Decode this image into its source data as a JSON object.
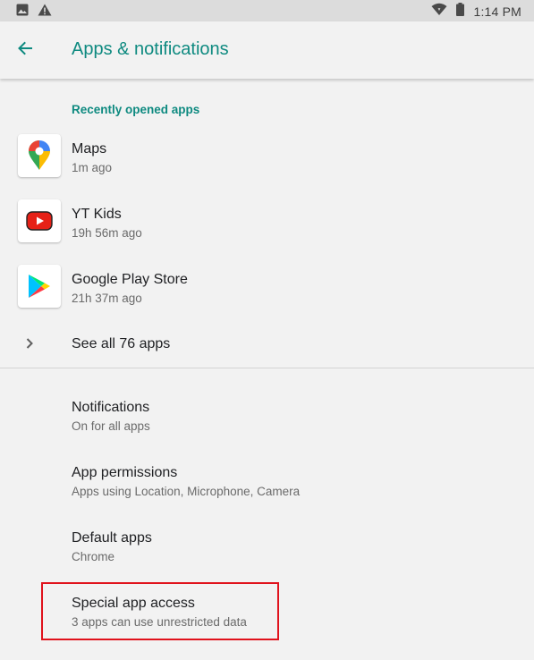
{
  "status_bar": {
    "time": "1:14 PM",
    "icons": [
      "image-icon",
      "warning-icon",
      "wifi-icon",
      "battery-icon"
    ]
  },
  "header": {
    "title": "Apps & notifications",
    "back_icon": "arrow-back-icon"
  },
  "recent": {
    "header": "Recently opened apps",
    "apps": [
      {
        "name": "Maps",
        "time": "1m ago",
        "icon": "maps-icon"
      },
      {
        "name": "YT Kids",
        "time": "19h 56m ago",
        "icon": "yt-kids-icon"
      },
      {
        "name": "Google Play Store",
        "time": "21h 37m ago",
        "icon": "play-store-icon"
      }
    ],
    "see_all": "See all 76 apps"
  },
  "prefs": [
    {
      "title": "Notifications",
      "summary": "On for all apps"
    },
    {
      "title": "App permissions",
      "summary": "Apps using Location, Microphone, Camera"
    },
    {
      "title": "Default apps",
      "summary": "Chrome"
    },
    {
      "title": "Special app access",
      "summary": "3 apps can use unrestricted data"
    }
  ],
  "colors": {
    "accent": "#0e8a80",
    "highlight": "#e0121c",
    "background": "#f2f2f2"
  }
}
